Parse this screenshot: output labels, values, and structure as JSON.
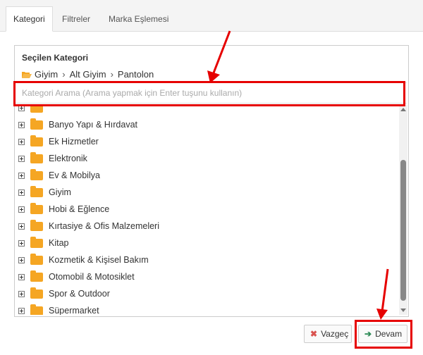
{
  "tabs": [
    {
      "label": "Kategori",
      "active": true
    },
    {
      "label": "Filtreler",
      "active": false
    },
    {
      "label": "Marka Eşlemesi",
      "active": false
    }
  ],
  "selected": {
    "title": "Seçilen Kategori",
    "path": [
      "Giyim",
      "Alt Giyim",
      "Pantolon"
    ]
  },
  "search": {
    "placeholder": "Kategori Arama (Arama yapmak için Enter tuşunu kullanın)",
    "value": ""
  },
  "tree": {
    "items": [
      {
        "label": "Banyo Yapı & Hırdavat"
      },
      {
        "label": "Ek Hizmetler"
      },
      {
        "label": "Elektronik"
      },
      {
        "label": "Ev & Mobilya"
      },
      {
        "label": "Giyim"
      },
      {
        "label": "Hobi & Eğlence"
      },
      {
        "label": "Kırtasiye & Ofis Malzemeleri"
      },
      {
        "label": "Kitap"
      },
      {
        "label": "Kozmetik & Kişisel Bakım"
      },
      {
        "label": "Otomobil & Motosiklet"
      },
      {
        "label": "Spor & Outdoor"
      },
      {
        "label": "Süpermarket"
      }
    ]
  },
  "buttons": {
    "cancel": {
      "label": "Vazgeç",
      "icon": "times-icon"
    },
    "next": {
      "label": "Devam",
      "icon": "arrow-right-icon"
    }
  },
  "colors": {
    "folder": "#f5a623",
    "highlight": "#e60000",
    "cancel_icon": "#d9534f",
    "next_icon": "#2e8b57"
  }
}
